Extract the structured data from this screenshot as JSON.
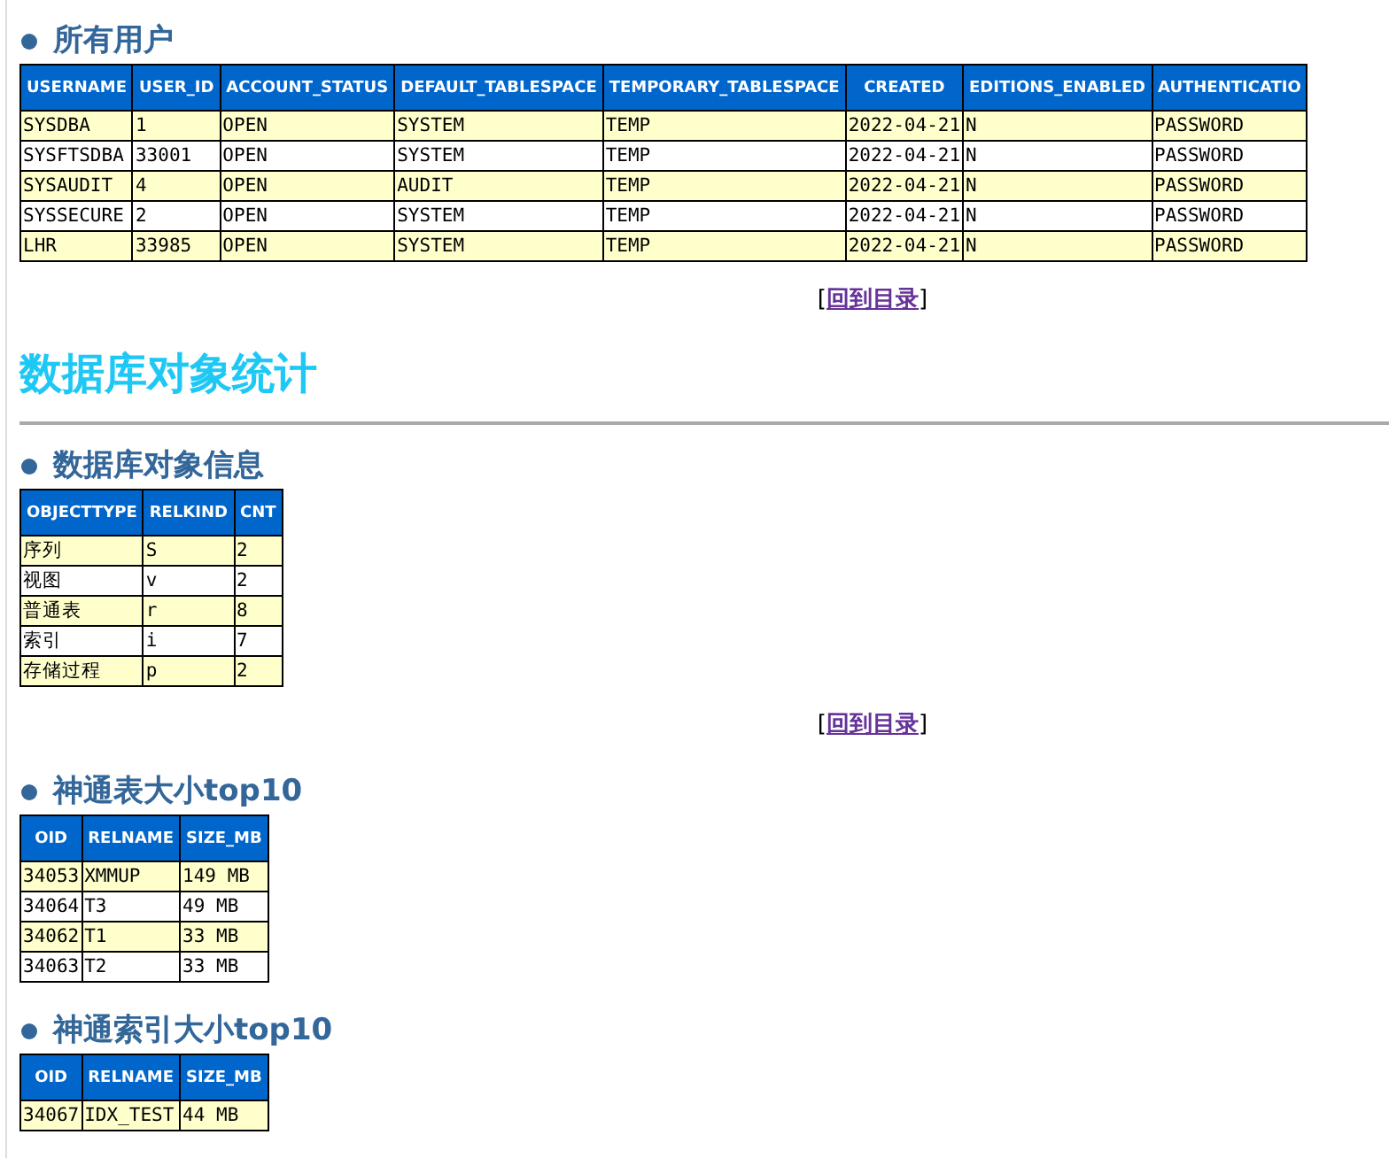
{
  "sections": [
    {
      "kind": "subsection",
      "title": "所有用户",
      "table": {
        "columns": [
          "USERNAME",
          "USER_ID",
          "ACCOUNT_STATUS",
          "DEFAULT_TABLESPACE",
          "TEMPORARY_TABLESPACE",
          "CREATED",
          "EDITIONS_ENABLED",
          "AUTHENTICATIO"
        ],
        "rows": [
          [
            "SYSDBA",
            "1",
            "OPEN",
            "SYSTEM",
            "TEMP",
            "2022-04-21",
            "N",
            "PASSWORD"
          ],
          [
            "SYSFTSDBA",
            "33001",
            "OPEN",
            "SYSTEM",
            "TEMP",
            "2022-04-21",
            "N",
            "PASSWORD"
          ],
          [
            "SYSAUDIT",
            "4",
            "OPEN",
            "AUDIT",
            "TEMP",
            "2022-04-21",
            "N",
            "PASSWORD"
          ],
          [
            "SYSSECURE",
            "2",
            "OPEN",
            "SYSTEM",
            "TEMP",
            "2022-04-21",
            "N",
            "PASSWORD"
          ],
          [
            "LHR",
            "33985",
            "OPEN",
            "SYSTEM",
            "TEMP",
            "2022-04-21",
            "N",
            "PASSWORD"
          ]
        ]
      }
    },
    {
      "kind": "back_link",
      "left": "[",
      "label": "回到目录",
      "right": "]"
    },
    {
      "kind": "heading",
      "title": "数据库对象统计"
    },
    {
      "kind": "subsection",
      "title": "数据库对象信息",
      "table": {
        "columns": [
          "OBJECTTYPE",
          "RELKIND",
          "CNT"
        ],
        "rows": [
          [
            "序列",
            "S",
            "2"
          ],
          [
            "视图",
            "v",
            "2"
          ],
          [
            "普通表",
            "r",
            "8"
          ],
          [
            "索引",
            "i",
            "7"
          ],
          [
            "存储过程",
            "p",
            "2"
          ]
        ]
      }
    },
    {
      "kind": "back_link",
      "left": "[",
      "label": "回到目录",
      "right": "]"
    },
    {
      "kind": "subsection",
      "title": "神通表大小top10",
      "table": {
        "columns": [
          "OID",
          "RELNAME",
          "SIZE_MB"
        ],
        "rows": [
          [
            "34053",
            "XMMUP",
            "149 MB"
          ],
          [
            "34064",
            "T3",
            "49 MB"
          ],
          [
            "34062",
            "T1",
            "33 MB"
          ],
          [
            "34063",
            "T2",
            "33 MB"
          ]
        ]
      }
    },
    {
      "kind": "subsection",
      "title": "神通索引大小top10",
      "table": {
        "columns": [
          "OID",
          "RELNAME",
          "SIZE_MB"
        ],
        "rows": [
          [
            "34067",
            "IDX_TEST",
            "44 MB"
          ]
        ]
      }
    }
  ]
}
